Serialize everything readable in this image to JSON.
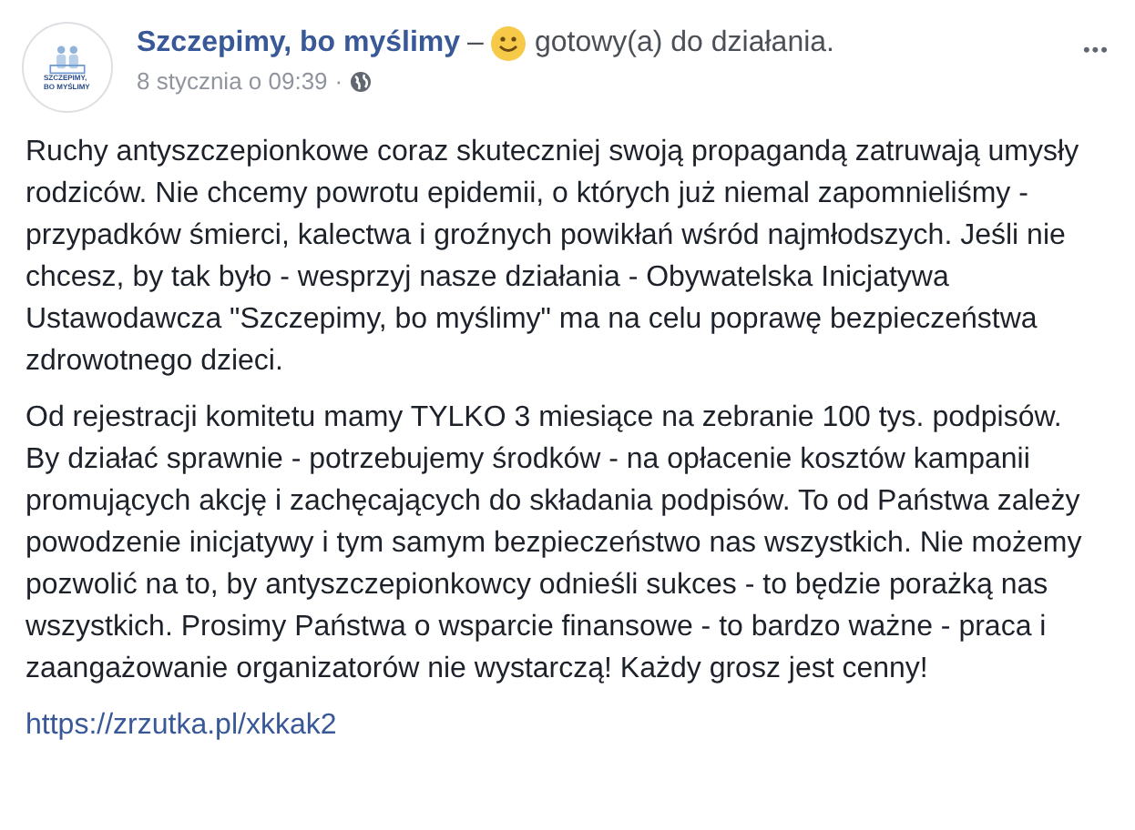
{
  "post": {
    "logo_text": "SZCZEPIMY, BO MYŚLIMY",
    "author": "Szczepimy, bo myślimy",
    "separator": "–",
    "feeling": "gotowy(a) do działania.",
    "date": "8 stycznia o 09:39",
    "dot": "·",
    "menu": "•••",
    "paragraphs": [
      "Ruchy antyszczepionkowe coraz skuteczniej swoją propagandą zatruwają umysły rodziców. Nie chcemy powrotu epidemii, o których już niemal zapomnieliśmy - przypadków śmierci, kalectwa i groźnych powikłań wśród najmłodszych. Jeśli nie chcesz, by tak było - wesprzyj nasze działania - Obywatelska Inicjatywa Ustawodawcza \"Szczepimy, bo myślimy\" ma na celu poprawę bezpieczeństwa zdrowotnego dzieci.",
      "Od rejestracji komitetu mamy TYLKO 3 miesiące na zebranie 100 tys. podpisów. By działać sprawnie - potrzebujemy środków - na opłacenie kosztów kampanii promujących akcję i zachęcających do składania podpisów. To od Państwa zależy powodzenie inicjatywy i tym samym bezpieczeństwo nas wszystkich. Nie możemy pozwolić na to, by antyszczepionkowcy odnieśli sukces - to będzie porażką nas wszystkich. Prosimy Państwa o wsparcie finansowe - to bardzo ważne - praca i zaangażowanie organizatorów nie wystarczą! Każdy grosz jest cenny!"
    ],
    "link": "https://zrzutka.pl/xkkak2"
  }
}
